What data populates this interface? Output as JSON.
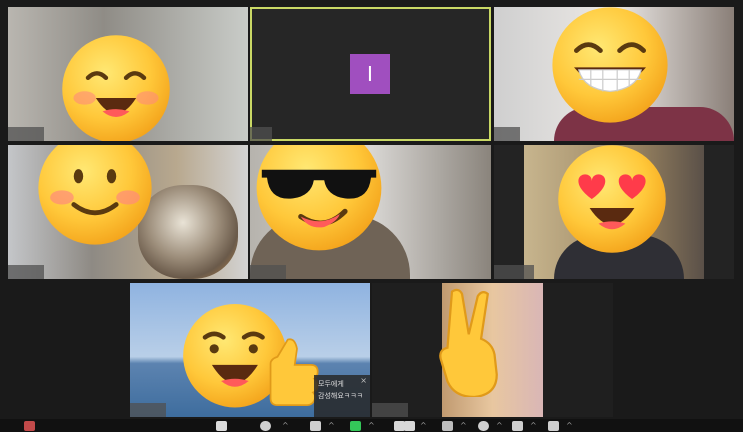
{
  "participants": [
    {
      "id": "p1",
      "emoji": "grinning-face-emoji"
    },
    {
      "id": "p2",
      "avatar_letter": "I",
      "avatar_color": "#a04fbf",
      "active": true
    },
    {
      "id": "p3",
      "emoji": "beaming-face-emoji"
    },
    {
      "id": "p4",
      "emoji": "smiling-face-emoji"
    },
    {
      "id": "p5",
      "emoji": "sunglasses-face-emoji"
    },
    {
      "id": "p6",
      "emoji": "heart-eyes-face-emoji"
    },
    {
      "id": "p7",
      "emoji": "thumbs-up-face-emoji"
    },
    {
      "id": "p8",
      "emoji": "victory-hand-emoji"
    }
  ],
  "chat": {
    "line1": "모두에게",
    "line2": "감성해요ㅋㅋㅋ",
    "close": "×"
  },
  "colors": {
    "active_border": "#c9d865",
    "avatar": "#a04fbf",
    "background": "#1a1a1a"
  },
  "toolbar": {
    "icons": [
      "mic-icon",
      "video-icon",
      "security-icon",
      "participants-icon",
      "chat-icon",
      "share-screen-icon",
      "record-icon",
      "captions-icon",
      "reactions-icon",
      "apps-icon",
      "whiteboard-icon"
    ]
  }
}
